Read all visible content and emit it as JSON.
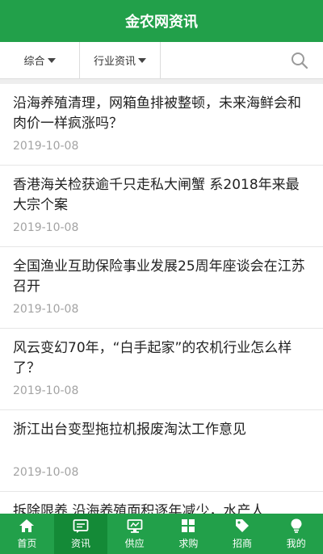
{
  "header": {
    "title": "金农网资讯"
  },
  "filters": [
    {
      "label": "综合"
    },
    {
      "label": "行业资讯"
    }
  ],
  "articles": [
    {
      "title": "沿海养殖清理，网箱鱼排被整顿，未来海鲜会和肉价一样疯涨吗？",
      "date": "2019-10-08"
    },
    {
      "title": "香港海关检获逾千只走私大闸蟹 系2018年来最大宗个案",
      "date": "2019-10-08"
    },
    {
      "title": "全国渔业互助保险事业发展25周年座谈会在江苏召开",
      "date": "2019-10-08"
    },
    {
      "title": "风云变幻70年，“白手起家”的农机行业怎么样了？",
      "date": "2019-10-08"
    },
    {
      "title": "浙江出台变型拖拉机报废淘汰工作意见",
      "date": "2019-10-08"
    },
    {
      "title": "拆除限养 沿海养殖面积逐年减少，水产人",
      "date": ""
    }
  ],
  "tabs": [
    {
      "label": "首页",
      "icon": "home-icon"
    },
    {
      "label": "资讯",
      "icon": "news-icon"
    },
    {
      "label": "供应",
      "icon": "supply-icon"
    },
    {
      "label": "求购",
      "icon": "grid-icon"
    },
    {
      "label": "招商",
      "icon": "tag-icon"
    },
    {
      "label": "我的",
      "icon": "bulb-icon"
    }
  ],
  "colors": {
    "brand": "#22a04a",
    "active_tab": "#148a37",
    "date": "#a3a3a3"
  }
}
